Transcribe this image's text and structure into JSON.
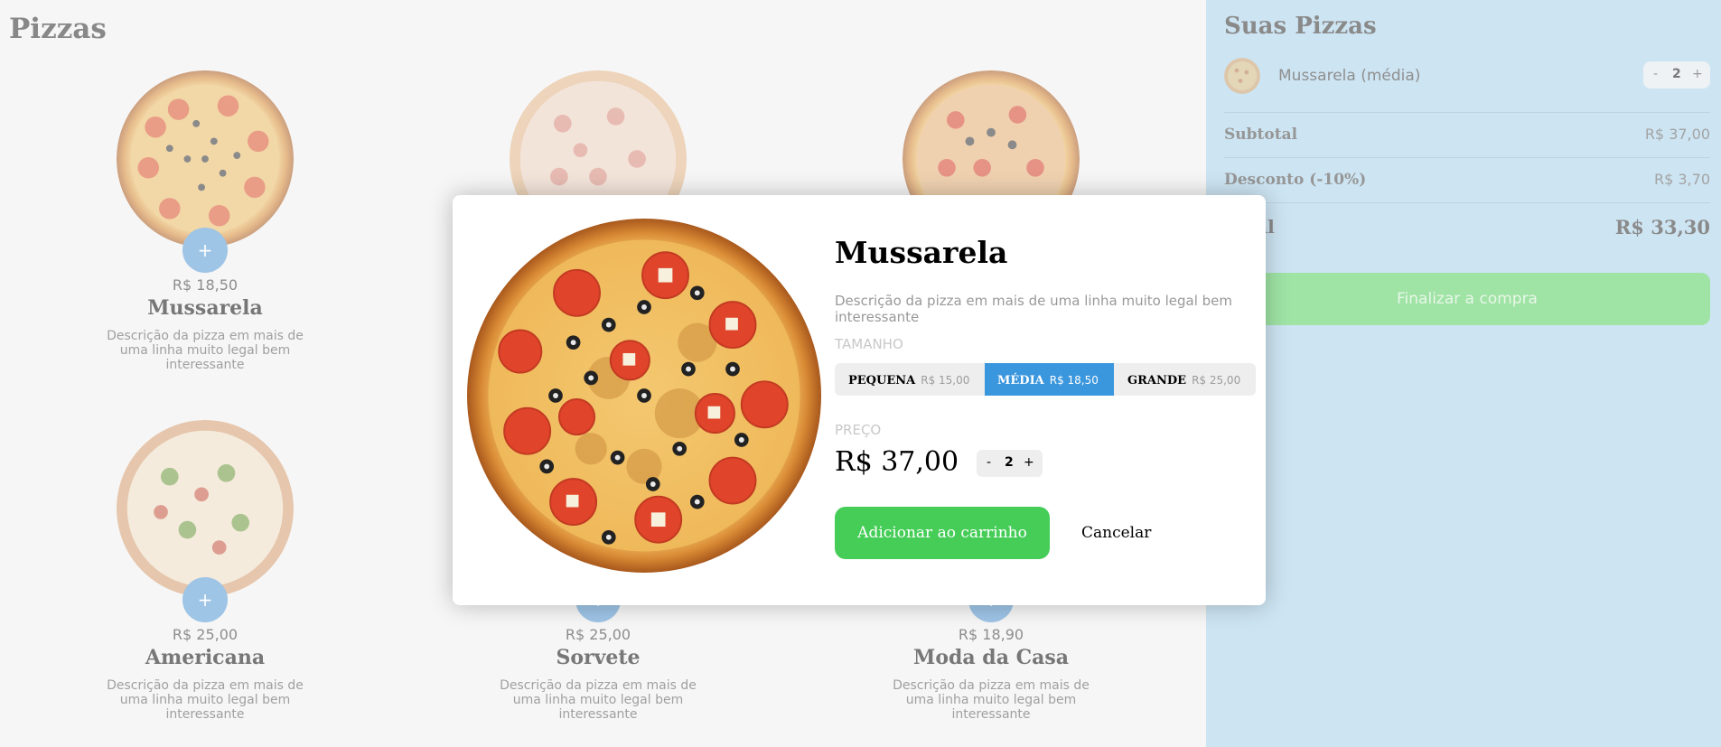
{
  "menu": {
    "title": "Pizzas",
    "pizzas": [
      {
        "name": "Mussarela",
        "price": "R$ 18,50",
        "description": "Descrição da pizza em mais de uma linha muito legal bem interessante",
        "add_label": "+"
      },
      {
        "name": "",
        "price": "",
        "description": "",
        "add_label": ""
      },
      {
        "name": "",
        "price": "",
        "description": "",
        "add_label": ""
      },
      {
        "name": "Americana",
        "price": "R$ 25,00",
        "description": "Descrição da pizza em mais de uma linha muito legal bem interessante",
        "add_label": "+"
      },
      {
        "name": "Sorvete",
        "price": "R$ 25,00",
        "description": "Descrição da pizza em mais de uma linha muito legal bem interessante",
        "add_label": "+"
      },
      {
        "name": "Moda da Casa",
        "price": "R$ 18,90",
        "description": "Descrição da pizza em mais de uma linha muito legal bem interessante",
        "add_label": "+"
      }
    ]
  },
  "cart": {
    "title": "Suas Pizzas",
    "items": [
      {
        "name": "Mussarela (média)",
        "qty": "2",
        "minus": "-",
        "plus": "+"
      }
    ],
    "subtotal_label": "Subtotal",
    "subtotal_value": "R$ 37,00",
    "discount_label": "Desconto (-10%)",
    "discount_value": "R$ 3,70",
    "total_label": "Total",
    "total_value": "R$ 33,30",
    "checkout_label": "Finalizar a compra"
  },
  "modal": {
    "title": "Mussarela",
    "description": "Descrição da pizza em mais de uma linha muito legal bem interessante",
    "size_label": "TAMANHO",
    "sizes": [
      {
        "name": "PEQUENA",
        "price": "R$ 15,00"
      },
      {
        "name": "MÉDIA",
        "price": "R$ 18,50"
      },
      {
        "name": "GRANDE",
        "price": "R$ 25,00"
      }
    ],
    "selected_size": "MÉDIA",
    "price_label": "PREÇO",
    "price": "R$ 37,00",
    "qty": "2",
    "minus": "-",
    "plus": "+",
    "add_button": "Adicionar ao carrinho",
    "cancel_button": "Cancelar"
  },
  "colors": {
    "accent_blue": "#3a96dd",
    "add_green": "#45cd58",
    "cart_bg": "#cde4f2",
    "overlay_bg": "#f6f6f6"
  },
  "icons": {
    "add_pizza": "plus-icon",
    "pizza_image": "pizza-image"
  }
}
